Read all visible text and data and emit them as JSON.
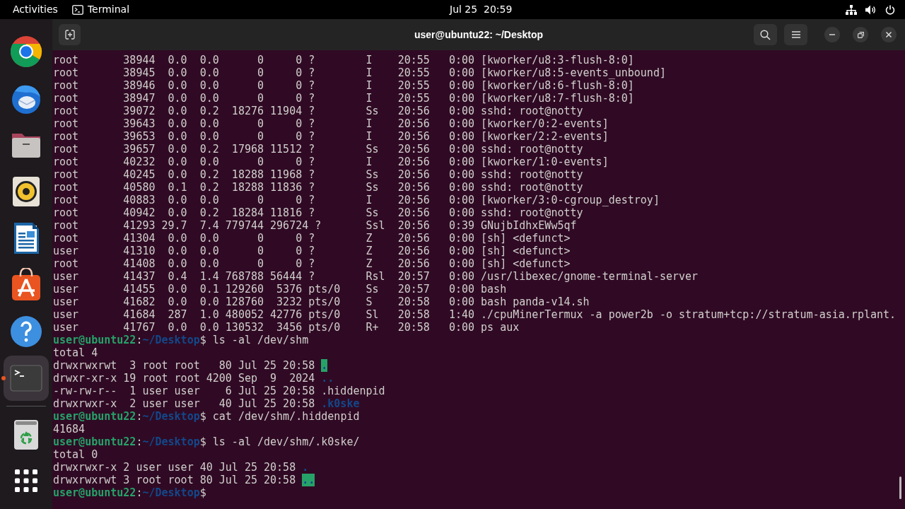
{
  "top_bar": {
    "activities": "Activities",
    "app": "Terminal",
    "clock": "Jul 25  20:59"
  },
  "dock": {
    "items": [
      {
        "kind": "browser",
        "selected": false
      },
      {
        "kind": "mail",
        "selected": false
      },
      {
        "kind": "files",
        "selected": false
      },
      {
        "kind": "music",
        "selected": false
      },
      {
        "kind": "document",
        "selected": false
      },
      {
        "kind": "store",
        "selected": false
      },
      {
        "kind": "help",
        "selected": false
      },
      {
        "kind": "terminal",
        "selected": true
      }
    ],
    "mounts": [
      {
        "kind": "trash"
      }
    ]
  },
  "window": {
    "title": "user@ubuntu22: ~/Desktop"
  },
  "lines": [
    {
      "kind": "text",
      "text": "root       38944  0.0  0.0      0     0 ?        I    20:55   0:00 [kworker/u8:3-flush-8:0]"
    },
    {
      "kind": "text",
      "text": "root       38945  0.0  0.0      0     0 ?        I    20:55   0:00 [kworker/u8:5-events_unbound]"
    },
    {
      "kind": "text",
      "text": "root       38946  0.0  0.0      0     0 ?        I    20:55   0:00 [kworker/u8:6-flush-8:0]"
    },
    {
      "kind": "text",
      "text": "root       38947  0.0  0.0      0     0 ?        I    20:55   0:00 [kworker/u8:7-flush-8:0]"
    },
    {
      "kind": "text",
      "text": "root       39072  0.0  0.2  18276 11904 ?        Ss   20:56   0:00 sshd: root@notty"
    },
    {
      "kind": "text",
      "text": "root       39643  0.0  0.0      0     0 ?        I    20:56   0:00 [kworker/0:2-events]"
    },
    {
      "kind": "text",
      "text": "root       39653  0.0  0.0      0     0 ?        I    20:56   0:00 [kworker/2:2-events]"
    },
    {
      "kind": "text",
      "text": "root       39657  0.0  0.2  17968 11512 ?        Ss   20:56   0:00 sshd: root@notty"
    },
    {
      "kind": "text",
      "text": "root       40232  0.0  0.0      0     0 ?        I    20:56   0:00 [kworker/1:0-events]"
    },
    {
      "kind": "text",
      "text": "root       40245  0.0  0.2  18288 11968 ?        Ss   20:56   0:00 sshd: root@notty"
    },
    {
      "kind": "text",
      "text": "root       40580  0.1  0.2  18288 11836 ?        Ss   20:56   0:00 sshd: root@notty"
    },
    {
      "kind": "text",
      "text": "root       40883  0.0  0.0      0     0 ?        I    20:56   0:00 [kworker/3:0-cgroup_destroy]"
    },
    {
      "kind": "text",
      "text": "root       40942  0.0  0.2  18284 11816 ?        Ss   20:56   0:00 sshd: root@notty"
    },
    {
      "kind": "text",
      "text": "root       41293 29.7  7.4 779744 296724 ?       Ssl  20:56   0:39 GNujbIdhxEWw5qf"
    },
    {
      "kind": "text",
      "text": "root       41304  0.0  0.0      0     0 ?        Z    20:56   0:00 [sh] <defunct>"
    },
    {
      "kind": "text",
      "text": "user       41310  0.0  0.0      0     0 ?        Z    20:56   0:00 [sh] <defunct>"
    },
    {
      "kind": "text",
      "text": "root       41408  0.0  0.0      0     0 ?        Z    20:56   0:00 [sh] <defunct>"
    },
    {
      "kind": "text",
      "text": "user       41437  0.4  1.4 768788 56444 ?        Rsl  20:57   0:00 /usr/libexec/gnome-terminal-server"
    },
    {
      "kind": "text",
      "text": "user       41455  0.0  0.1 129260  5376 pts/0    Ss   20:57   0:00 bash"
    },
    {
      "kind": "text",
      "text": "user       41682  0.0  0.0 128760  3232 pts/0    S    20:58   0:00 bash panda-v14.sh"
    },
    {
      "kind": "text",
      "text": "user       41684  287  1.0 480052 42776 pts/0    Sl   20:58   1:40 ./cpuMinerTermux -a power2b -o stratum+tcp://stratum-asia.rplant."
    },
    {
      "kind": "text",
      "text": "user       41767  0.0  0.0 130532  3456 pts/0    R+   20:58   0:00 ps aux"
    },
    {
      "kind": "prompt",
      "user_host": "user@ubuntu22",
      "colon": ":",
      "path": "~/Desktop",
      "dollar": "$",
      "command": "ls -al /dev/shm"
    },
    {
      "kind": "text",
      "text": "total 4"
    },
    {
      "kind": "listing_sticky",
      "text": "drwxrwxrwt  3 root root   80 Jul 25 20:58",
      "name": "."
    },
    {
      "kind": "listing_dir",
      "text": "drwxr-xr-x 19 root root 4200 Sep  9  2024",
      "name": ".."
    },
    {
      "kind": "listing_file",
      "text": "-rw-rw-r--  1 user user    6 Jul 25 20:58",
      "name": ".hiddenpid"
    },
    {
      "kind": "listing_dir",
      "text": "drwxrwxr-x  2 user user   40 Jul 25 20:58",
      "name": ".k0ske"
    },
    {
      "kind": "prompt",
      "user_host": "user@ubuntu22",
      "colon": ":",
      "path": "~/Desktop",
      "dollar": "$",
      "command": "cat /dev/shm/.hiddenpid"
    },
    {
      "kind": "text",
      "text": "41684"
    },
    {
      "kind": "prompt",
      "user_host": "user@ubuntu22",
      "colon": ":",
      "path": "~/Desktop",
      "dollar": "$",
      "command": "ls -al /dev/shm/.k0ske/"
    },
    {
      "kind": "text",
      "text": "total 0"
    },
    {
      "kind": "listing_dir",
      "text": "drwxrwxr-x 2 user user 40 Jul 25 20:58",
      "name": "."
    },
    {
      "kind": "listing_sticky",
      "text": "drwxrwxrwt 3 root root 80 Jul 25 20:58",
      "name": ".."
    },
    {
      "kind": "prompt",
      "user_host": "user@ubuntu22",
      "colon": ":",
      "path": "~/Desktop",
      "dollar": "$"
    }
  ]
}
